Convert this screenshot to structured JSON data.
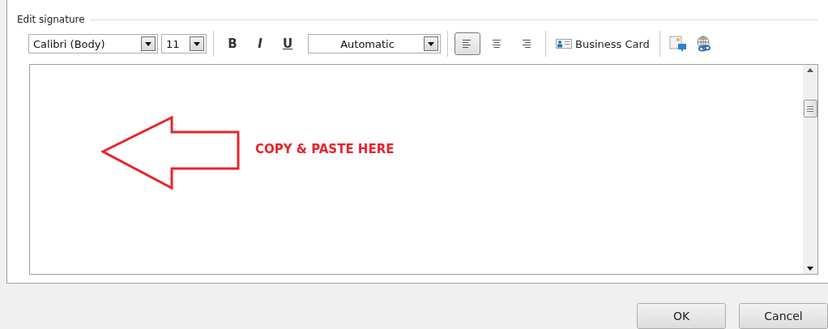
{
  "group_title": "Edit signature",
  "toolbar": {
    "font": "Calibri (Body)",
    "size": "11",
    "format_buttons": [
      {
        "kind": "bold",
        "label": "B"
      },
      {
        "kind": "italic",
        "label": "I"
      },
      {
        "kind": "underline",
        "label": "U"
      }
    ],
    "text_color_choice": "Automatic",
    "alignment": [
      {
        "kind": "left",
        "selected": true
      },
      {
        "kind": "center",
        "selected": false
      },
      {
        "kind": "right",
        "selected": false
      }
    ],
    "business_card": "Business Card"
  },
  "editor": {
    "callout": "COPY & PASTE HERE"
  },
  "buttons": [
    "OK",
    "Cancel"
  ]
}
